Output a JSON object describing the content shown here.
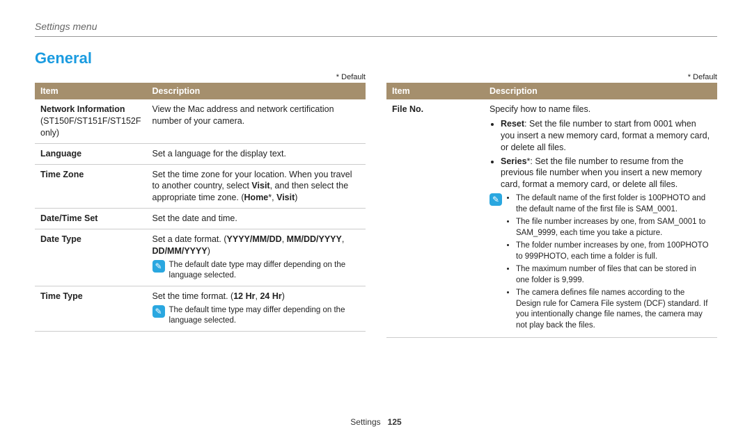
{
  "top_label": "Settings menu",
  "heading": "General",
  "default_note": "* Default",
  "headers": {
    "item": "Item",
    "desc": "Description"
  },
  "left": [
    {
      "item": "Network Information",
      "item_sub": "(ST150F/ST151F/ST152F only)",
      "desc_plain": "View the Mac address and network certification number of your camera."
    },
    {
      "item": "Language",
      "desc_plain": "Set a language for the display text."
    },
    {
      "item": "Time Zone",
      "desc_html": "Set the time zone for your location. When you travel to another country, select <b>Visit</b>, and then select the appropriate time zone. (<b>Home</b>*, <b>Visit</b>)"
    },
    {
      "item": "Date/Time Set",
      "desc_plain": "Set the date and time."
    },
    {
      "item": "Date Type",
      "desc_html": "Set a date format. (<b>YYYY/MM/DD</b>, <b>MM/DD/YYYY</b>, <b>DD/MM/YYYY</b>)",
      "note_single": "The default date type may differ depending on the language selected."
    },
    {
      "item": "Time Type",
      "desc_html": "Set the time format. (<b>12 Hr</b>, <b>24 Hr</b>)",
      "note_single": "The default time type may differ depending on the language selected."
    }
  ],
  "right": [
    {
      "item": "File No.",
      "desc_intro": "Specify how to name files.",
      "desc_bullets_html": [
        "<b>Reset</b>: Set the file number to start from 0001 when you insert a new memory card, format a memory card, or delete all files.",
        "<b>Series</b>*: Set the file number to resume from the previous file number when you insert a new memory card, format a memory card, or delete all files."
      ],
      "note_bullets": [
        "The default name of the first folder is 100PHOTO and the default name of the first file is SAM_0001.",
        "The file number increases by one, from SAM_0001 to SAM_9999, each time you take a picture.",
        "The folder number increases by one, from 100PHOTO to 999PHOTO, each time a folder is full.",
        "The maximum number of files that can be stored in one folder is 9,999.",
        "The camera defines file names according to the Design rule for Camera File system (DCF) standard. If you intentionally change file names, the camera may not play back the files."
      ]
    }
  ],
  "footer": {
    "label": "Settings",
    "page": "125"
  },
  "colors": {
    "accent": "#1a9be0",
    "th_bg": "#a58f6d"
  }
}
